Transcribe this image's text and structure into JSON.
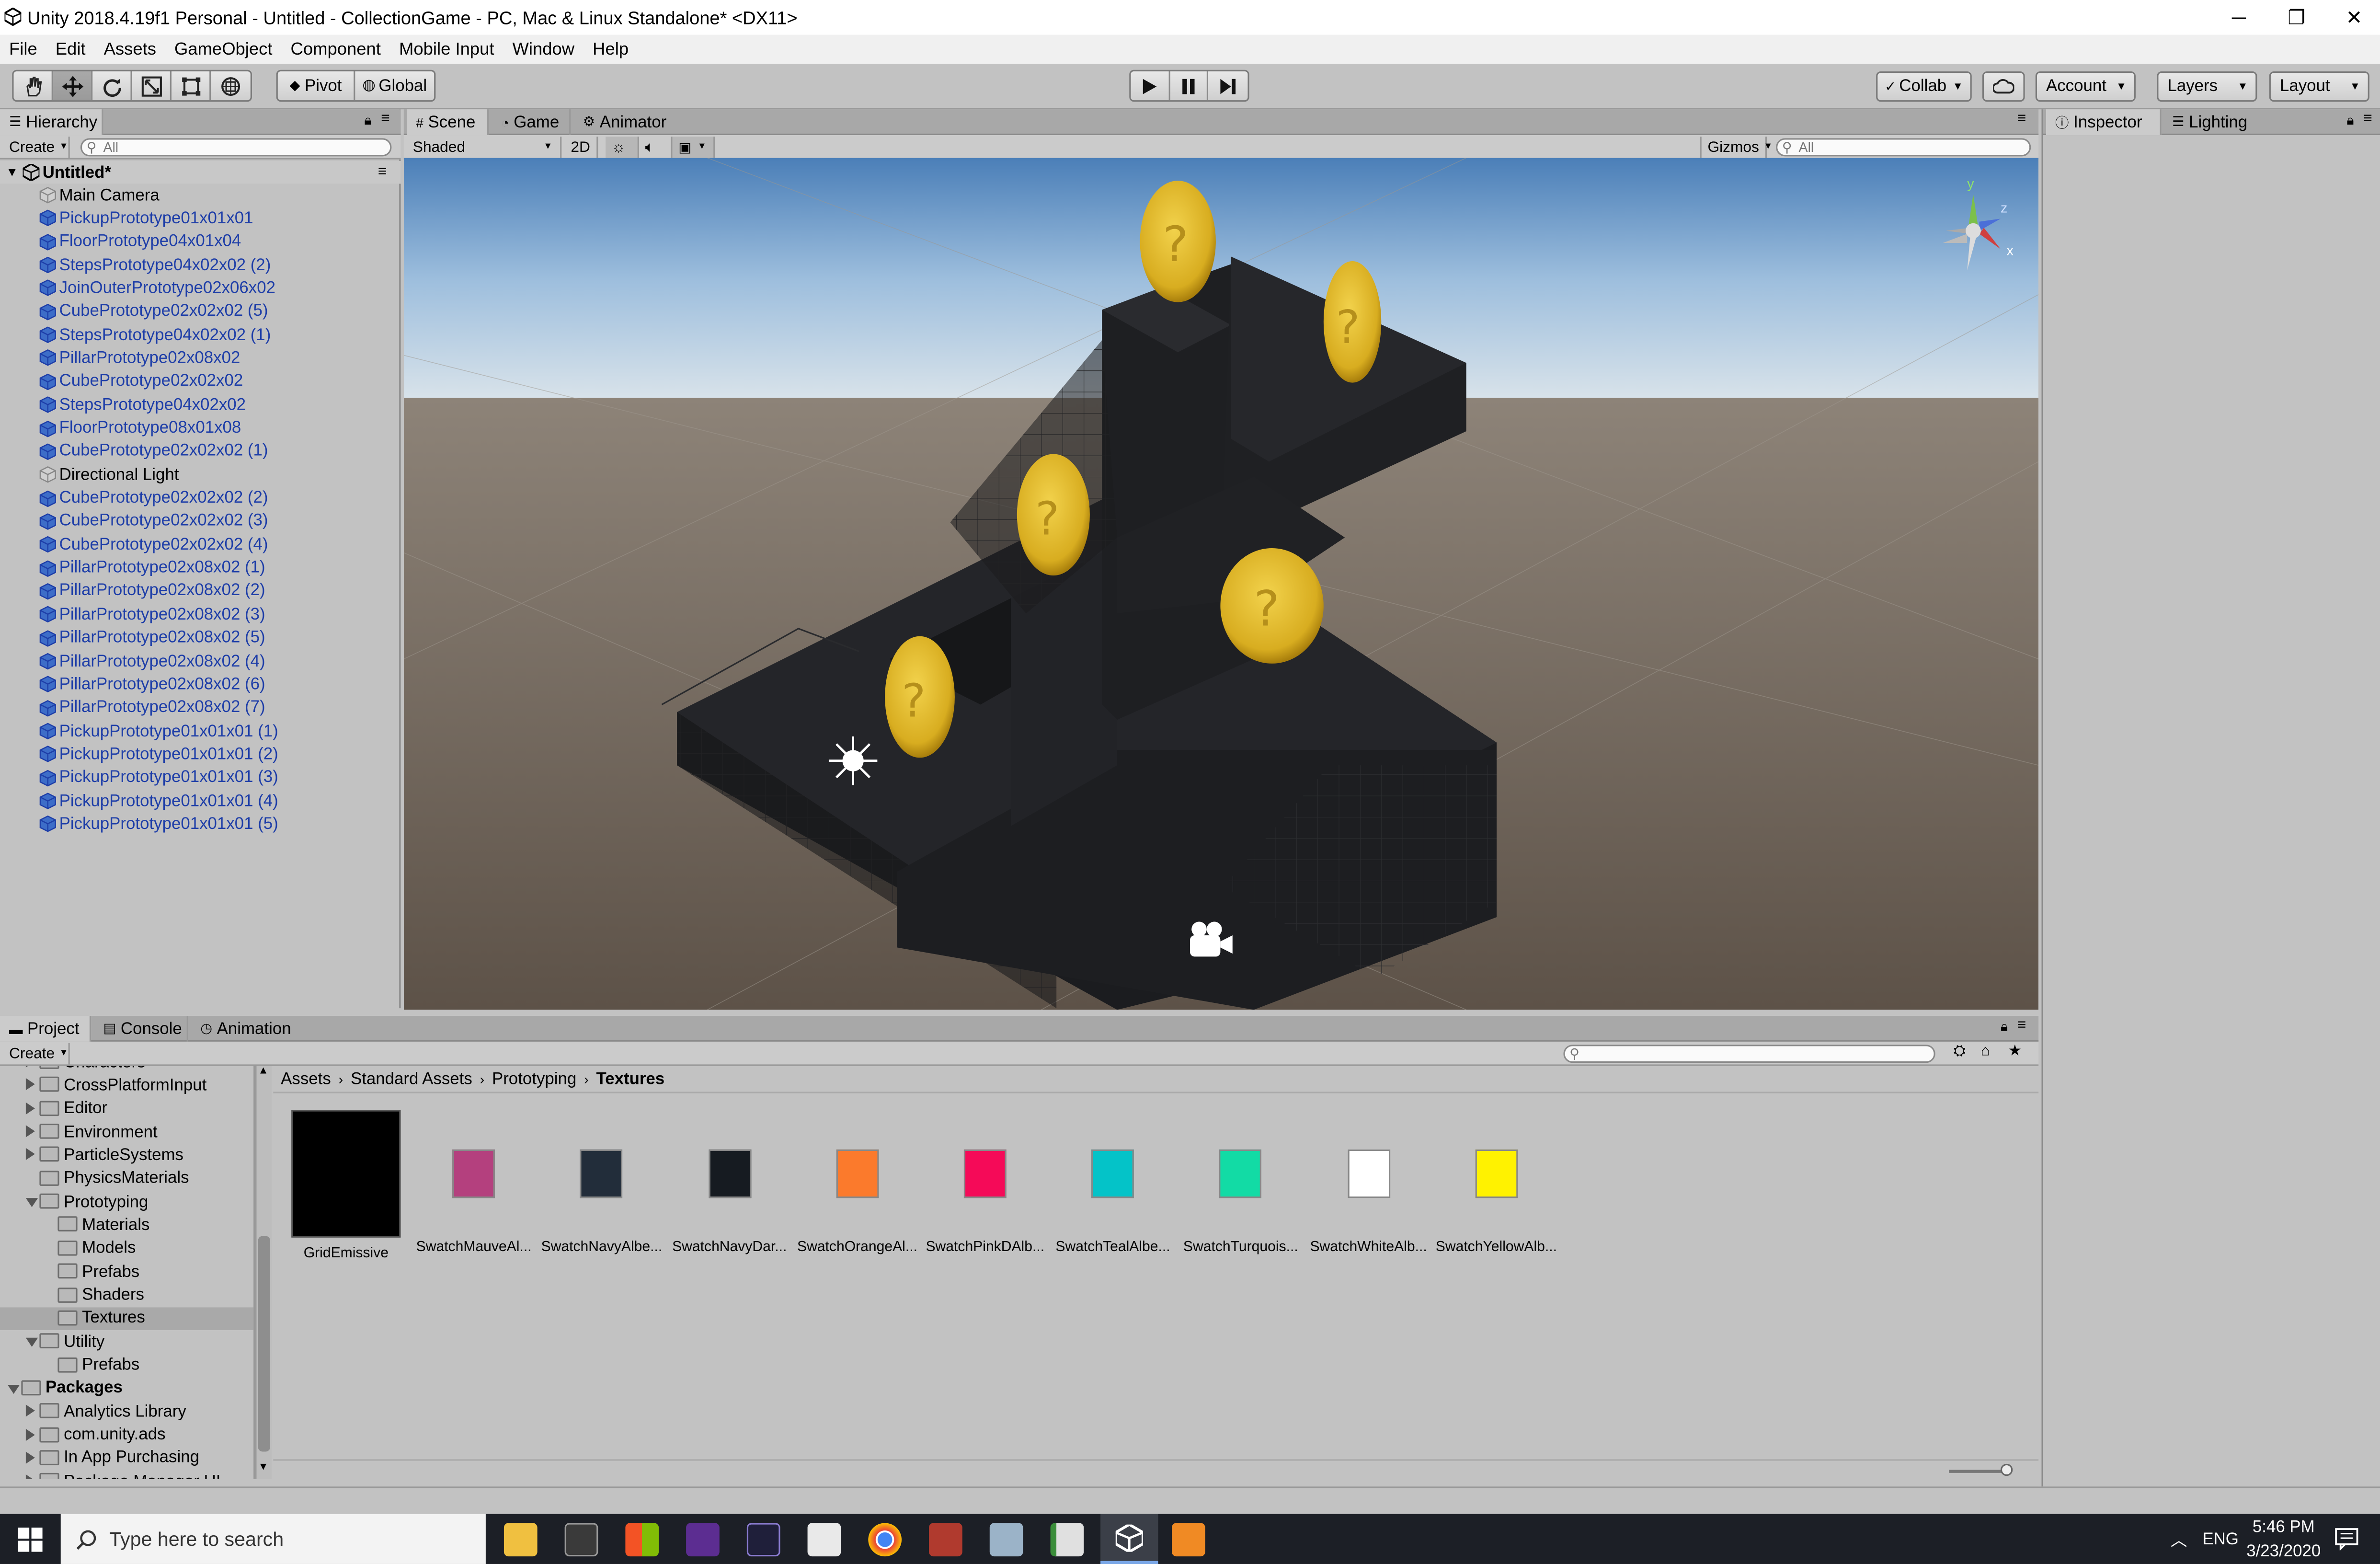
{
  "window": {
    "title": "Unity 2018.4.19f1 Personal - Untitled - CollectionGame - PC, Mac & Linux Standalone* <DX11>",
    "minimize": "─",
    "restore": "❐",
    "close": "✕"
  },
  "menu": [
    "File",
    "Edit",
    "Assets",
    "GameObject",
    "Component",
    "Mobile Input",
    "Window",
    "Help"
  ],
  "toolbar": {
    "pivot": "Pivot",
    "global": "Global",
    "collab": "Collab",
    "account": "Account",
    "layers": "Layers",
    "layout": "Layout"
  },
  "hierarchy": {
    "tab": "Hierarchy",
    "create": "Create",
    "search_placeholder": "All",
    "scene_name": "Untitled*",
    "items": [
      {
        "label": "Main Camera",
        "prefab": false
      },
      {
        "label": "PickupPrototype01x01x01",
        "prefab": true
      },
      {
        "label": "FloorPrototype04x01x04",
        "prefab": true
      },
      {
        "label": "StepsPrototype04x02x02 (2)",
        "prefab": true
      },
      {
        "label": "JoinOuterPrototype02x06x02",
        "prefab": true
      },
      {
        "label": "CubePrototype02x02x02 (5)",
        "prefab": true
      },
      {
        "label": "StepsPrototype04x02x02 (1)",
        "prefab": true
      },
      {
        "label": "PillarPrototype02x08x02",
        "prefab": true
      },
      {
        "label": "CubePrototype02x02x02",
        "prefab": true
      },
      {
        "label": "StepsPrototype04x02x02",
        "prefab": true
      },
      {
        "label": "FloorPrototype08x01x08",
        "prefab": true
      },
      {
        "label": "CubePrototype02x02x02 (1)",
        "prefab": true
      },
      {
        "label": "Directional Light",
        "prefab": false
      },
      {
        "label": "CubePrototype02x02x02 (2)",
        "prefab": true
      },
      {
        "label": "CubePrototype02x02x02 (3)",
        "prefab": true
      },
      {
        "label": "CubePrototype02x02x02 (4)",
        "prefab": true
      },
      {
        "label": "PillarPrototype02x08x02 (1)",
        "prefab": true
      },
      {
        "label": "PillarPrototype02x08x02 (2)",
        "prefab": true
      },
      {
        "label": "PillarPrototype02x08x02 (3)",
        "prefab": true
      },
      {
        "label": "PillarPrototype02x08x02 (5)",
        "prefab": true
      },
      {
        "label": "PillarPrototype02x08x02 (4)",
        "prefab": true
      },
      {
        "label": "PillarPrototype02x08x02 (6)",
        "prefab": true
      },
      {
        "label": "PillarPrototype02x08x02 (7)",
        "prefab": true
      },
      {
        "label": "PickupPrototype01x01x01 (1)",
        "prefab": true
      },
      {
        "label": "PickupPrototype01x01x01 (2)",
        "prefab": true
      },
      {
        "label": "PickupPrototype01x01x01 (3)",
        "prefab": true
      },
      {
        "label": "PickupPrototype01x01x01 (4)",
        "prefab": true
      },
      {
        "label": "PickupPrototype01x01x01 (5)",
        "prefab": true
      }
    ]
  },
  "scene": {
    "tabs": [
      "Scene",
      "Game",
      "Animator"
    ],
    "shading": "Shaded",
    "mode_2d": "2D",
    "gizmos": "Gizmos",
    "search_placeholder": "All",
    "axis_y": "y",
    "axis_z": "z",
    "axis_x": "x"
  },
  "inspector": {
    "tabs": [
      "Inspector",
      "Lighting"
    ]
  },
  "project": {
    "tabs": [
      "Project",
      "Console",
      "Animation"
    ],
    "create": "Create",
    "breadcrumb": [
      "Assets",
      "Standard Assets",
      "Prototyping",
      "Textures"
    ],
    "tree": [
      {
        "label": "Characters",
        "indent": 1,
        "arrow": "right"
      },
      {
        "label": "CrossPlatformInput",
        "indent": 1,
        "arrow": "right"
      },
      {
        "label": "Editor",
        "indent": 1,
        "arrow": "right"
      },
      {
        "label": "Environment",
        "indent": 1,
        "arrow": "right"
      },
      {
        "label": "ParticleSystems",
        "indent": 1,
        "arrow": "right"
      },
      {
        "label": "PhysicsMaterials",
        "indent": 1,
        "arrow": "none"
      },
      {
        "label": "Prototyping",
        "indent": 1,
        "arrow": "down"
      },
      {
        "label": "Materials",
        "indent": 2,
        "arrow": "none"
      },
      {
        "label": "Models",
        "indent": 2,
        "arrow": "none"
      },
      {
        "label": "Prefabs",
        "indent": 2,
        "arrow": "none"
      },
      {
        "label": "Shaders",
        "indent": 2,
        "arrow": "none"
      },
      {
        "label": "Textures",
        "indent": 2,
        "arrow": "none",
        "selected": true
      },
      {
        "label": "Utility",
        "indent": 1,
        "arrow": "down"
      },
      {
        "label": "Prefabs",
        "indent": 2,
        "arrow": "none"
      },
      {
        "label": "Packages",
        "indent": 0,
        "arrow": "down",
        "bold": true
      },
      {
        "label": "Analytics Library",
        "indent": 1,
        "arrow": "right"
      },
      {
        "label": "com.unity.ads",
        "indent": 1,
        "arrow": "right"
      },
      {
        "label": "In App Purchasing",
        "indent": 1,
        "arrow": "right"
      },
      {
        "label": "Package Manager UI",
        "indent": 1,
        "arrow": "right"
      }
    ],
    "assets": [
      {
        "label": "GridEmissive",
        "color": "#000000",
        "big": true
      },
      {
        "label": "SwatchMauveAl...",
        "color": "#b4407e"
      },
      {
        "label": "SwatchNavyAlbe...",
        "color": "#222d3a"
      },
      {
        "label": "SwatchNavyDar...",
        "color": "#161b21"
      },
      {
        "label": "SwatchOrangeAl...",
        "color": "#fb7a2c"
      },
      {
        "label": "SwatchPinkDAlb...",
        "color": "#f50a58"
      },
      {
        "label": "SwatchTealAlbe...",
        "color": "#04c3c8"
      },
      {
        "label": "SwatchTurquois...",
        "color": "#12dba5"
      },
      {
        "label": "SwatchWhiteAlb...",
        "color": "#ffffff"
      },
      {
        "label": "SwatchYellowAlb...",
        "color": "#fff200"
      }
    ]
  },
  "taskbar": {
    "search_placeholder": "Type here to search",
    "lang": "ENG",
    "time": "5:46 PM",
    "date": "3/23/2020"
  }
}
